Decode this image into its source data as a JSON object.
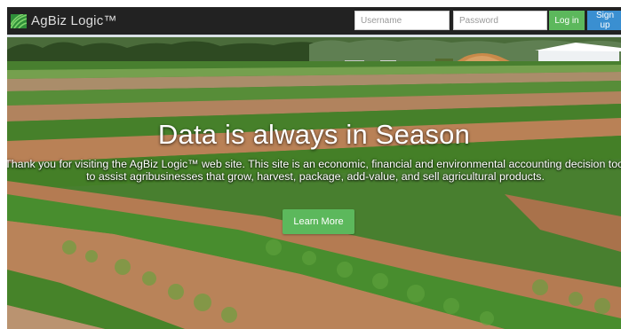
{
  "navbar": {
    "brand": "AgBiz Logic™",
    "username_placeholder": "Username",
    "password_placeholder": "Password",
    "login_label": "Log in",
    "signup_label": "Sign up"
  },
  "hero": {
    "headline": "Data is always in Season",
    "description": "Thank you for visiting the AgBiz Logic™ web site. This site is an economic, financial and environmental accounting decision tool to assist agribusinesses that grow, harvest, package, add-value, and sell agricultural products.",
    "cta_label": "Learn More"
  },
  "colors": {
    "navbar_bg": "#222222",
    "login_button": "#5cb85c",
    "signup_button": "#3a8fd1",
    "cta_button": "#5cb85c"
  },
  "icons": {
    "brand_logo": "agbiz-leaf-logo"
  }
}
